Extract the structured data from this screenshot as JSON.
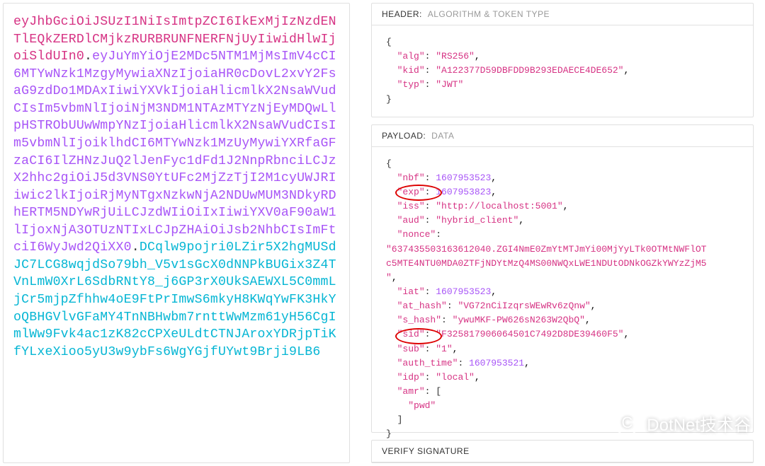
{
  "token": {
    "header": "eyJhbGciOiJSUzI1NiIsImtpZCI6IkExMjIzNzdENTlEQkZERDlCMjkzRURBRUNFNERFNjUyIiwidHlwIjoiSldUIn0",
    "payload": "eyJuYmYiOjE2MDc5NTM1MjMsImV4cCI6MTYwNzk1MzgyMywiaXNzIjoiaHR0cDovL2xvY2FsaG9zdDo1MDAxIiwiYXVkIjoiaHlicmlkX2NsaWVudCIsIm5vbmNlIjoiNjM3NDM1NTAzMTYzNjEyMDQwLlpHSTRObUUwWmpYNzIjoiaHlicmlkX2NsaWVudCIsIm5vbmNlIjoiklhdCI6MTYwNzk1MzUyMywiYXRfaGFzaCI6IlZHNzJuQ2lJenFyc1dFd1J2NnpRbnciLCJzX2hhc2giOiJ5d3VNS0YtUFc2MjZzTjI2M1cyUWJRIiwic2lkIjoiRjMyNTgxNzkwNjA2NDUwMUM3NDkyRDhERTM5NDYwRjUiLCJzdWIiOiIxIiwiYXV0aF90aW1lIjoxNjA3OTUzNTIxLCJpZHAiOiJsb2NhbCIsImFtciI6WyJwd2QiXX0",
    "signature": "DCqlw9pojri0LZir5X2hgMUSdJC7LCG8wqjdSo79bh_V5v1sGcX0dNNPkBUGix3Z4TVnLmW0XrL6SdbRNtY8_j6GP3rX0UkSAEWXL5C0mmLjCr5mjpZfhhw4oE9FtPrImwS6mkyH8KWqYwFK3HkYoQBHGVlvGFaMY4TnNBHwbm7rnttWwMzm61yH56CgImlWw9Fvk4ac1zK82cCPXeULdtCTNJAroxYDRjpTiKfYLxeXioo5yU3w9ybFs6WgYGjfUYwt9Brji9LB6"
  },
  "sections": {
    "header": {
      "label": "HEADER:",
      "sub": "ALGORITHM & TOKEN TYPE",
      "data": {
        "alg": "RS256",
        "kid": "A122377D59DBFDD9B293EDAECE4DE652",
        "typ": "JWT"
      }
    },
    "payload": {
      "label": "PAYLOAD:",
      "sub": "DATA",
      "data": {
        "nbf": 1607953523,
        "exp": 1607953823,
        "iss": "http://localhost:5001",
        "aud": "hybrid_client",
        "nonce": "637435503163612040.ZGI4NmE0ZmYtMTJmYi00MjYyLTk0OTMtNWFlOTc5MTE4NTU0MDA0ZTFjNDYtMzQ4MS00NWQxLWE1NDUtODNkOGZkYWYzZjM5",
        "iat": 1607953523,
        "at_hash": "VG72nCiIzqrsWEwRv6zQnw",
        "s_hash": "ywuMKF-PW626sN263W2QbQ",
        "sid": "F325817906064501C7492D8DE39460F5",
        "sub": "1",
        "auth_time": 1607953521,
        "idp": "local",
        "amr": [
          "pwd"
        ]
      }
    },
    "verify": {
      "label": "VERIFY SIGNATURE"
    }
  },
  "watermark": {
    "text": "DotNet技术谷",
    "icon": "C"
  },
  "annotations": {
    "circle_iss": true,
    "circle_sub": true
  }
}
